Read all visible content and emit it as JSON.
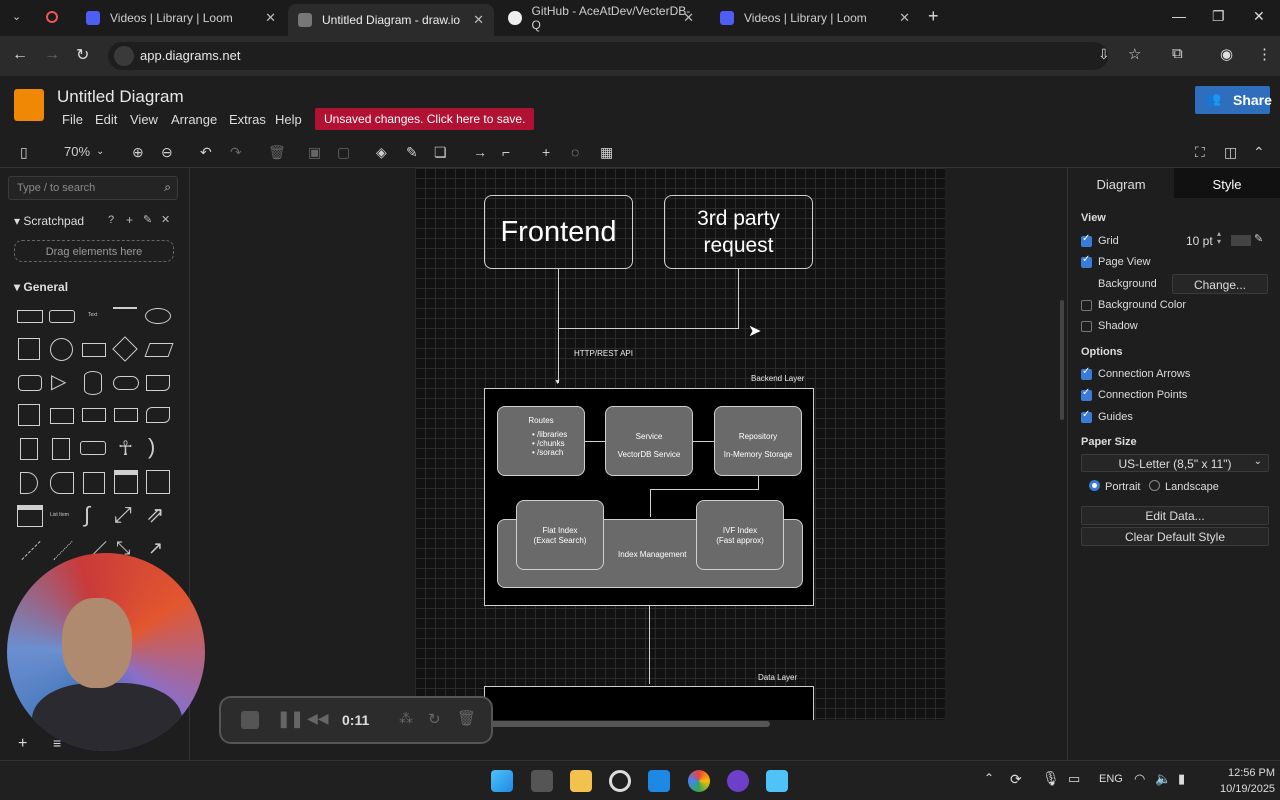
{
  "browser": {
    "tabs": [
      {
        "title": "Videos | Library | Loom",
        "color": "#625df5"
      },
      {
        "title": "Untitled Diagram - draw.io",
        "color": "#f08705"
      },
      {
        "title": "GitHub - AceAtDev/VecterDB-Q",
        "color": "#ffffff"
      },
      {
        "title": "Videos | Library | Loom",
        "color": "#625df5"
      }
    ],
    "url": "app.diagrams.net"
  },
  "app": {
    "title": "Untitled Diagram",
    "menu": [
      "File",
      "Edit",
      "View",
      "Arrange",
      "Extras",
      "Help"
    ],
    "unsaved_banner": "Unsaved changes. Click here to save.",
    "share_label": "Share",
    "zoom": "70%"
  },
  "sidebar": {
    "search_placeholder": "Type / to search",
    "scratchpad": "Scratchpad",
    "drag_hint": "Drag elements here",
    "general": "General"
  },
  "diagram": {
    "frontend": "Frontend",
    "third_party": "3rd party request",
    "http_label": "HTTP/REST API",
    "backend_layer": "Backend Layer",
    "routes_title": "Routes",
    "routes_items": [
      "/libraries",
      "/chunks",
      "/sorach"
    ],
    "service": "Service",
    "service_sub": "VectorDB Service",
    "repository": "Repository",
    "repository_sub": "In-Memory Storage",
    "flat_index": "Flat Index",
    "flat_index_sub": "(Exact Search)",
    "index_mgmt": "Index Management",
    "ivf_index": "IVF Index",
    "ivf_index_sub": "(Fast approx)",
    "data_layer": "Data Layer"
  },
  "format_panel": {
    "tabs": [
      "Diagram",
      "Style"
    ],
    "view_head": "View",
    "grid": "Grid",
    "grid_size": "10 pt",
    "page_view": "Page View",
    "background": "Background",
    "change_btn": "Change...",
    "background_color": "Background Color",
    "shadow": "Shadow",
    "options_head": "Options",
    "connection_arrows": "Connection Arrows",
    "connection_points": "Connection Points",
    "guides": "Guides",
    "paper_size_head": "Paper Size",
    "paper_size": "US-Letter (8,5\" x 11\")",
    "portrait": "Portrait",
    "landscape": "Landscape",
    "edit_data": "Edit Data...",
    "clear_style": "Clear Default Style"
  },
  "loom": {
    "time": "0:11"
  },
  "taskbar": {
    "lang": "ENG",
    "time": "12:56 PM",
    "date": "10/19/2025"
  }
}
